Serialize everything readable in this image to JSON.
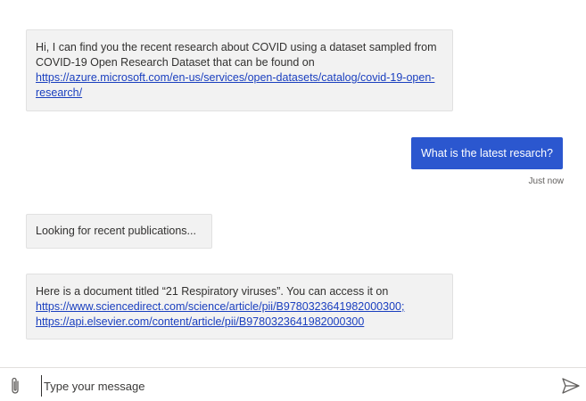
{
  "messages": {
    "m1": {
      "text": "Hi, I can find you the recent research about COVID using a dataset sampled from COVID-19 Open Research Dataset that can be found on ",
      "link": "https://azure.microsoft.com/en-us/services/open-datasets/catalog/covid-19-open-research/"
    },
    "m2": {
      "text": "What is the latest resarch?",
      "timestamp": "Just now"
    },
    "m3": {
      "text": "Looking for recent publications..."
    },
    "m4": {
      "text": "Here is a document titled “21 Respiratory viruses”. You can access it on ",
      "link1": "https://www.sciencedirect.com/science/article/pii/B9780323641982000300;",
      "link2": "https://api.elsevier.com/content/article/pii/B9780323641982000300"
    }
  },
  "composer": {
    "placeholder": "Type your message",
    "attach_icon": "paperclip-icon",
    "send_icon": "send-icon"
  },
  "colors": {
    "user_bubble": "#2b57cf",
    "bot_bubble": "#f2f2f2",
    "link": "#1a3fbf"
  }
}
